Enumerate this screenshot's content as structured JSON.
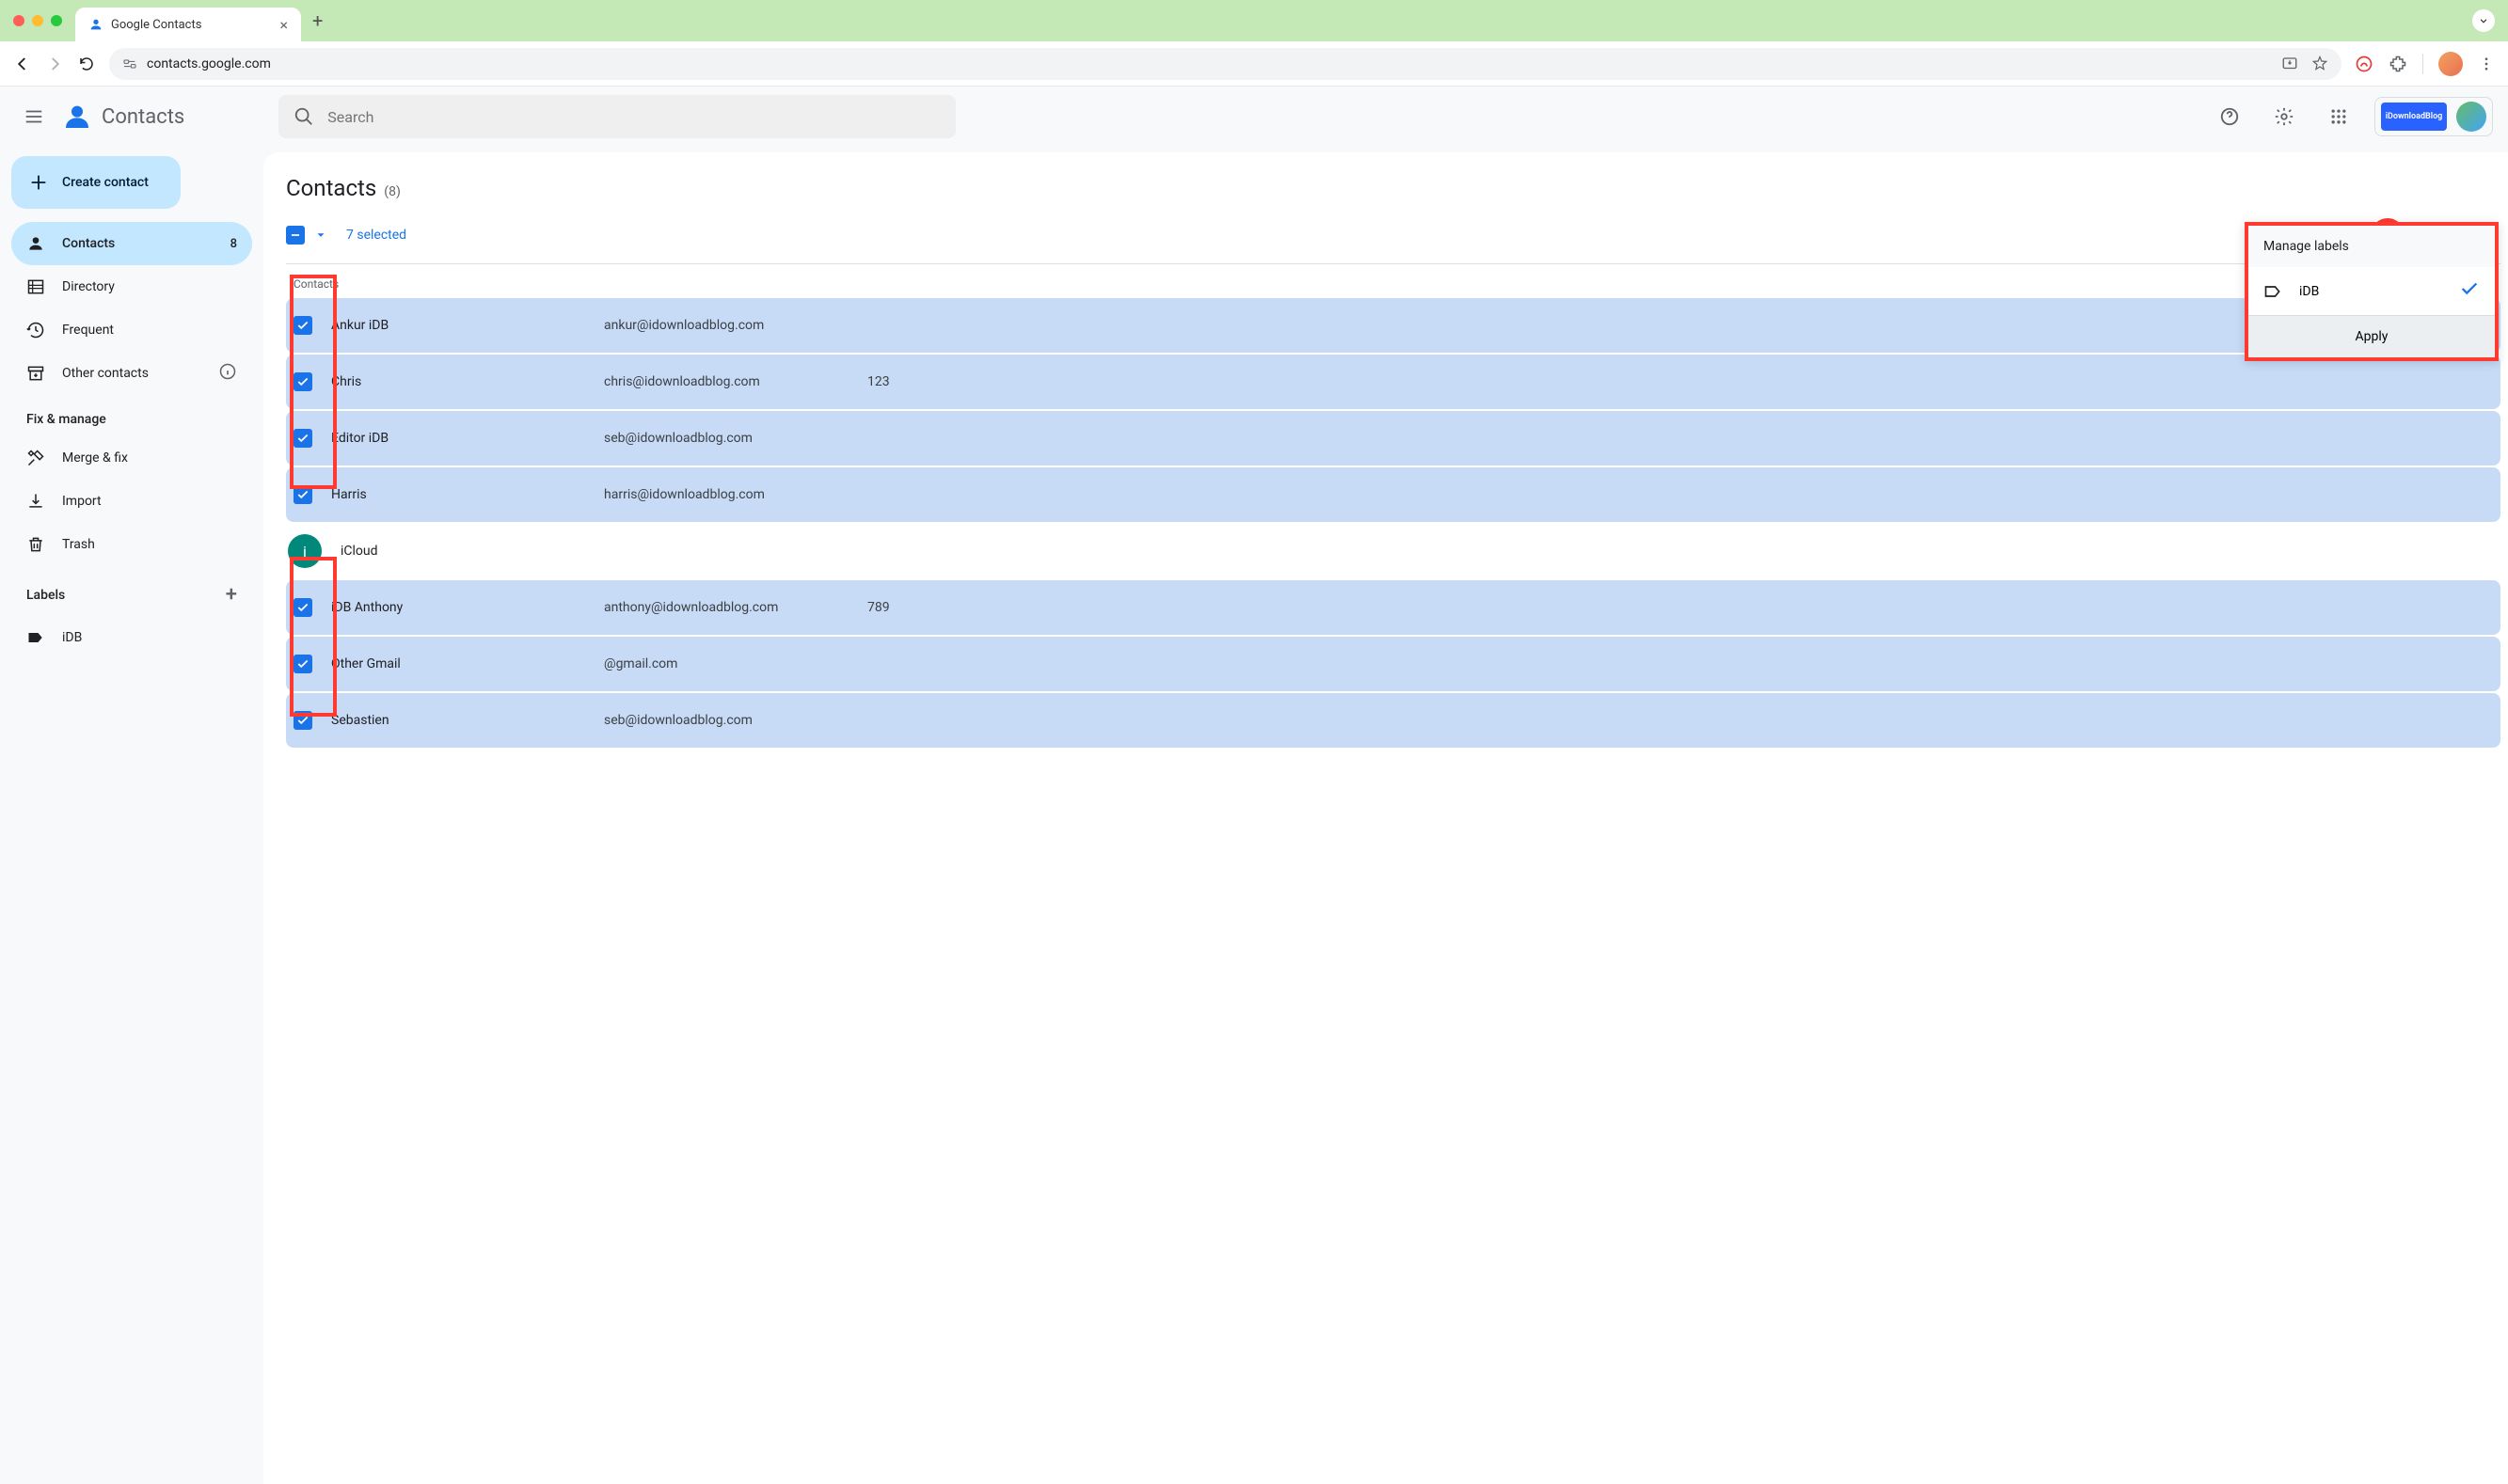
{
  "browser": {
    "tab_title": "Google Contacts",
    "url": "contacts.google.com"
  },
  "header": {
    "app_title": "Contacts",
    "search_placeholder": "Search",
    "badge_text": "iDownloadBlog"
  },
  "sidebar": {
    "create_label": "Create contact",
    "items": [
      {
        "label": "Contacts",
        "count": "8"
      },
      {
        "label": "Directory"
      },
      {
        "label": "Frequent"
      },
      {
        "label": "Other contacts"
      }
    ],
    "fix_header": "Fix & manage",
    "fix_items": [
      {
        "label": "Merge & fix"
      },
      {
        "label": "Import"
      },
      {
        "label": "Trash"
      }
    ],
    "labels_header": "Labels",
    "labels": [
      {
        "label": "iDB"
      }
    ]
  },
  "main": {
    "title": "Contacts",
    "count": "(8)",
    "selected": "7 selected",
    "contacts_subhead": "Contacts"
  },
  "popup": {
    "title": "Manage labels",
    "label_name": "iDB",
    "apply": "Apply"
  },
  "contacts": [
    {
      "name": "Ankur iDB",
      "email": "ankur@idownloadblog.com",
      "phone": "",
      "selected": true
    },
    {
      "name": "Chris",
      "email": "chris@idownloadblog.com",
      "phone": "123",
      "selected": true
    },
    {
      "name": "Editor iDB",
      "email": "seb@idownloadblog.com",
      "phone": "",
      "selected": true
    },
    {
      "name": "Harris",
      "email": "harris@idownloadblog.com",
      "phone": "",
      "selected": true
    },
    {
      "name": "iCloud",
      "email": "",
      "phone": "",
      "selected": false,
      "avatar_initial": "i"
    },
    {
      "name": "iDB Anthony",
      "email": "anthony@idownloadblog.com",
      "phone": "789",
      "selected": true
    },
    {
      "name": "Other Gmail",
      "email": "@gmail.com",
      "phone": "",
      "selected": true,
      "email_blurred_prefix": true
    },
    {
      "name": "Sebastien",
      "email": "seb@idownloadblog.com",
      "phone": "",
      "selected": true
    }
  ]
}
